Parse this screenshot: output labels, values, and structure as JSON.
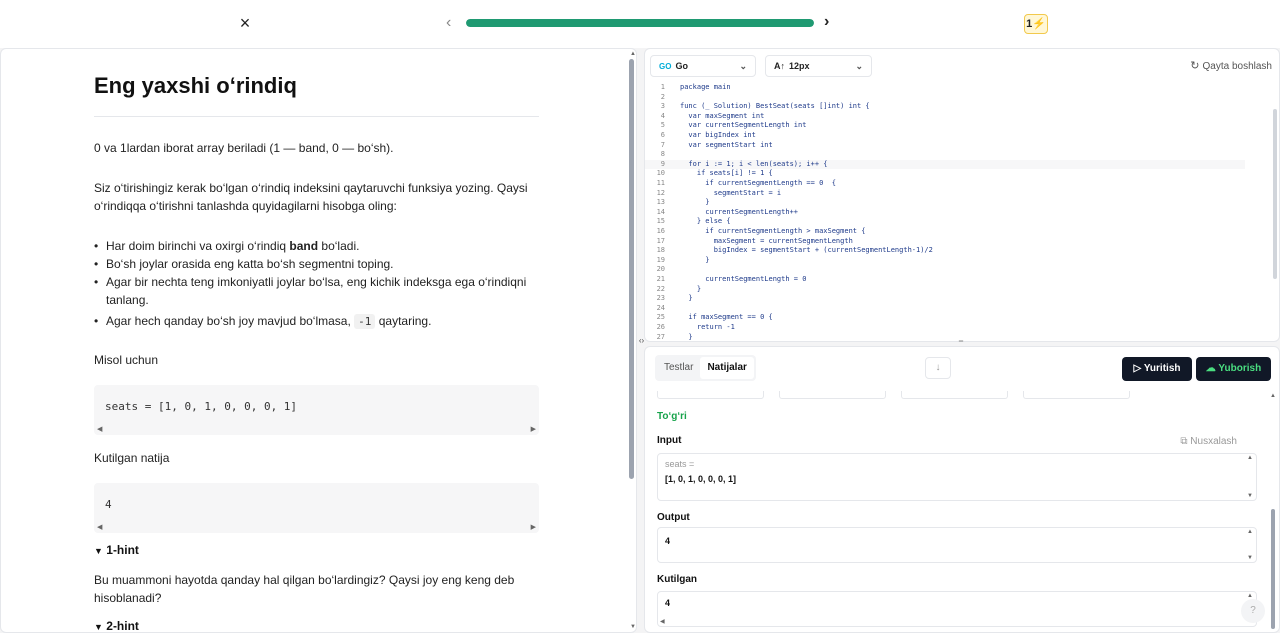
{
  "topbar": {
    "close_icon": "×",
    "prev_icon": "‹",
    "next_icon": "›",
    "progress_pct": 100,
    "streak_count": "1",
    "streak_icon": "⚡",
    "accent": "#1f9a72"
  },
  "problem": {
    "title": "Eng yaxshi o‘rindiq",
    "p1": "0 va 1lardan iborat array beriladi (1 — band, 0 — bo‘sh).",
    "p2": "Siz o‘tirishingiz kerak bo‘lgan o‘rindiq indeksini qaytaruvchi funksiya yozing. Qaysi o‘rindiqqa o‘tirishni tanlashda quyidagilarni hisobga oling:",
    "rule1_a": "Har doim birinchi va oxirgi o‘rindiq ",
    "rule1_b": "band",
    "rule1_c": " bo‘ladi.",
    "rule2": "Bo‘sh joylar orasida eng katta bo‘sh segmentni toping.",
    "rule3": "Agar bir nechta teng imkoniyatli joylar bo‘lsa, eng kichik indeksga ega o‘rindiqni tanlang.",
    "rule4_a": "Agar hech qanday bo‘sh joy mavjud bo‘lmasa, ",
    "rule4_code": "-1",
    "rule4_b": " qaytaring.",
    "example_label": "Misol uchun",
    "example_code": "seats = [1, 0, 1, 0, 0, 0, 1]",
    "expected_label": "Kutilgan natija",
    "expected_code": "4",
    "hint1_label": "1-hint",
    "hint1_body": "Bu muammoni hayotda qanday hal qilgan bo‘lardingiz? Qaysi joy eng keng deb hisoblanadi?",
    "hint2_label": "2-hint",
    "hint_icon": "▼"
  },
  "editor": {
    "language": "Go",
    "language_icon": "GO",
    "font_size": "12px",
    "font_size_icon": "A↑",
    "chevron": "⌄",
    "restart_label": "Qayta boshlash",
    "restart_icon": "↻",
    "lines": [
      {
        "n": "1",
        "t": "package main"
      },
      {
        "n": "2",
        "t": ""
      },
      {
        "n": "3",
        "t": "func (_ Solution) BestSeat(seats []int) int {"
      },
      {
        "n": "4",
        "t": "  var maxSegment int"
      },
      {
        "n": "5",
        "t": "  var currentSegmentLength int"
      },
      {
        "n": "6",
        "t": "  var bigIndex int"
      },
      {
        "n": "7",
        "t": "  var segmentStart int"
      },
      {
        "n": "8",
        "t": ""
      },
      {
        "n": "9",
        "t": "  for i := 1; i < len(seats); i++ {"
      },
      {
        "n": "10",
        "t": "    if seats[i] != 1 {"
      },
      {
        "n": "11",
        "t": "      if currentSegmentLength == 0  {"
      },
      {
        "n": "12",
        "t": "        segmentStart = i"
      },
      {
        "n": "13",
        "t": "      }"
      },
      {
        "n": "14",
        "t": "      currentSegmentLength++"
      },
      {
        "n": "15",
        "t": "    } else {"
      },
      {
        "n": "16",
        "t": "      if currentSegmentLength > maxSegment {"
      },
      {
        "n": "17",
        "t": "        maxSegment = currentSegmentLength"
      },
      {
        "n": "18",
        "t": "        bigIndex = segmentStart + (currentSegmentLength-1)/2"
      },
      {
        "n": "19",
        "t": "      }"
      },
      {
        "n": "20",
        "t": ""
      },
      {
        "n": "21",
        "t": "      currentSegmentLength = 0"
      },
      {
        "n": "22",
        "t": "    }"
      },
      {
        "n": "23",
        "t": "  }"
      },
      {
        "n": "24",
        "t": ""
      },
      {
        "n": "25",
        "t": "  if maxSegment == 0 {"
      },
      {
        "n": "26",
        "t": "    return -1"
      },
      {
        "n": "27",
        "t": "  }"
      }
    ]
  },
  "results": {
    "tab_tests": "Testlar",
    "tab_results": "Natijalar",
    "down_icon": "↓",
    "run_label": "Yuritish",
    "run_icon": "▷",
    "submit_label": "Yuborish",
    "submit_icon": "☁",
    "status": "To‘g‘ri",
    "status_color": "#16a34a",
    "input_label": "Input",
    "copy_label": "Nusxalash",
    "copy_icon": "⧉",
    "input_var": "seats =",
    "input_value": "[1, 0, 1, 0, 0, 0, 1]",
    "output_label": "Output",
    "output_value": "4",
    "expected_label": "Kutilgan",
    "expected_value": "4",
    "help_icon": "?"
  }
}
